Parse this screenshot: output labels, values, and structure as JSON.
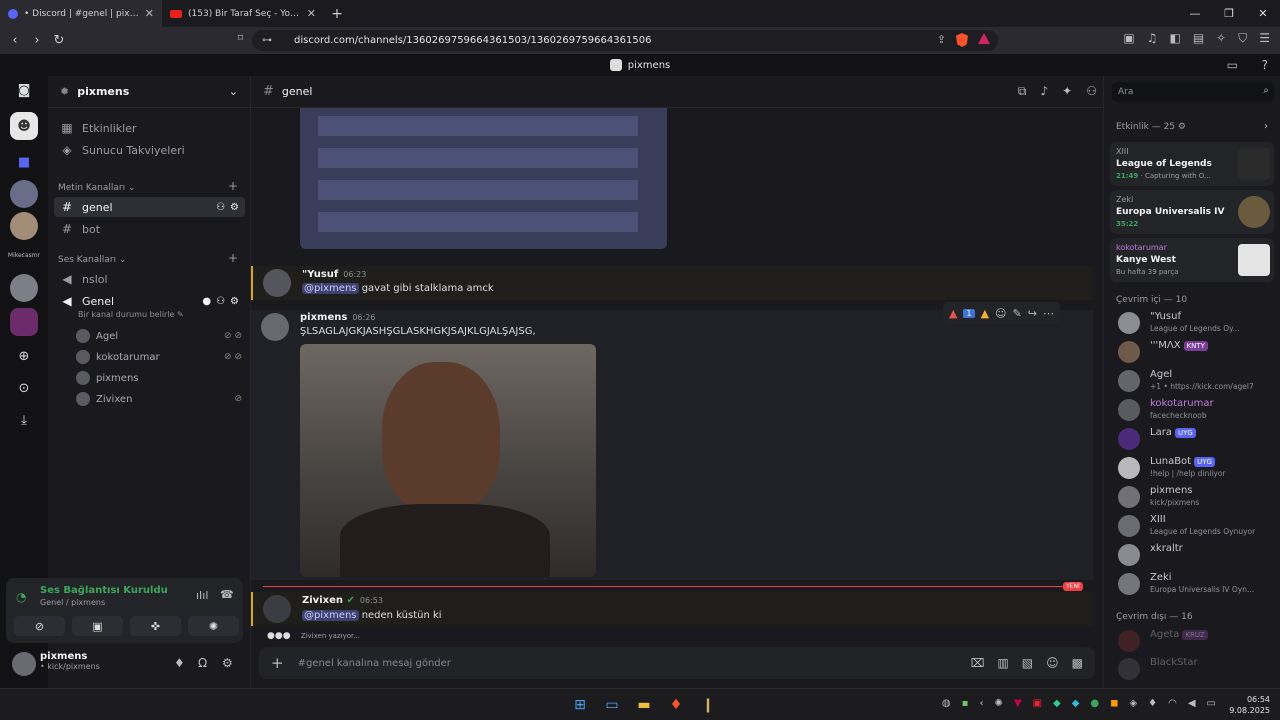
{
  "browser": {
    "tabs": [
      {
        "title": "• Discord | #genel | pixmens",
        "close": "✕"
      },
      {
        "title": "(153) Bir Taraf Seç - YouTube",
        "close": "✕"
      }
    ],
    "new_tab": "+",
    "url": "discord.com/channels/1360269759664361503/1360269759664361506"
  },
  "app_title": "pixmens",
  "guild": {
    "name": "pixmens"
  },
  "sidebar_links": [
    "Etkinlikler",
    "Sunucu Takviyeleri"
  ],
  "text_category": "Metin Kanalları",
  "text_channels": [
    "genel",
    "bot"
  ],
  "voice_category": "Ses Kanalları",
  "voice_channels": [
    "nslol",
    "Genel"
  ],
  "voice_status": "Bir kanal durumu belirle",
  "voice_users": [
    "Agel",
    "kokotarumar",
    "pixmens",
    "Zivixen"
  ],
  "server_label": "Mikecasmr",
  "voice_connection": {
    "title": "Ses Bağlantısı Kuruldu",
    "sub": "Genel / pixmens"
  },
  "user": {
    "name": "pixmens",
    "status": "• kick/pixmens"
  },
  "channel": {
    "name": "genel"
  },
  "messages": [
    {
      "author": "\"Yusuf",
      "time": "06:23",
      "mention": "@pixmens",
      "text": "gavat gibi stalklama amck"
    },
    {
      "author": "pixmens",
      "time": "06:26",
      "text": "ŞLSAGLAJGKJASHŞGLASKHGKJSAJKLGJALŞAJSG,"
    },
    {
      "author": "Zivixen",
      "time": "06:53",
      "mention": "@pixmens",
      "text": "neden küstün ki"
    }
  ],
  "new_label": "YENİ",
  "reaction_count": "1",
  "typing": "Zivixen yazıyor...",
  "composer_placeholder": "#genel kanalına mesaj gönder",
  "search_placeholder": "Ara",
  "activity_header": "Etkinlik — 25",
  "activity_cards": [
    {
      "user": "XIII",
      "game": "League of Legends",
      "time": "21:49",
      "extra": "Capturing with O..."
    },
    {
      "user": "Zeki",
      "game": "Europa Universalis IV",
      "time": "35:22",
      "extra": ""
    },
    {
      "user": "kokotarumar",
      "game": "Kanye West",
      "time": "",
      "extra": "Bu hafta 39 parça"
    }
  ],
  "online_header": "Çevrim içi — 10",
  "online_members": [
    {
      "name": "\"Yusuf",
      "status": "League of Legends Oy...",
      "color": "#c4c6cc",
      "badge": ""
    },
    {
      "name": "'''MΛX",
      "status": "",
      "color": "#c4c6cc",
      "badge": "KNTY"
    },
    {
      "name": "Agel",
      "status": "+1 • https://kick.com/agel7",
      "color": "#c4c6cc",
      "badge": ""
    },
    {
      "name": "kokotarumar",
      "status": "facechecknoob",
      "color": "#c678dd",
      "badge": ""
    },
    {
      "name": "Lara",
      "status": "",
      "color": "#c4c6cc",
      "badge": "UYG"
    },
    {
      "name": "LunaBot",
      "status": "!help | /help dinliyor",
      "color": "#c4c6cc",
      "badge": "UYG"
    },
    {
      "name": "pixmens",
      "status": "kick/pixmens",
      "color": "#c4c6cc",
      "badge": ""
    },
    {
      "name": "XIII",
      "status": "League of Legends Oynuyor",
      "color": "#c4c6cc",
      "badge": ""
    },
    {
      "name": "xkraltr",
      "status": "",
      "color": "#c4c6cc",
      "badge": ""
    },
    {
      "name": "Zeki",
      "status": "Europa Universalis IV Oyn...",
      "color": "#c4c6cc",
      "badge": ""
    }
  ],
  "offline_header": "Çevrim dışı — 16",
  "offline_members": [
    {
      "name": "Ageta",
      "badge": "KRUZ"
    },
    {
      "name": "BlackStar",
      "badge": ""
    }
  ],
  "clock": {
    "time": "06:54",
    "date": "9.08.2025"
  }
}
